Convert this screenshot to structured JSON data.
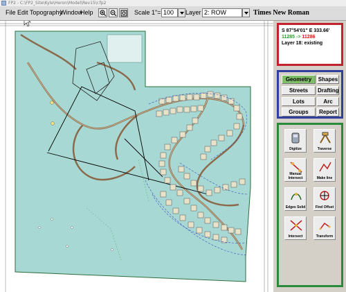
{
  "window": {
    "title": "FP2 - C:\\FP2_Site\\Kyle\\Heron\\Model\\Rev15\\r.fp2"
  },
  "menu": [
    "File",
    "Edit",
    "Topography",
    "Window",
    "Help"
  ],
  "toolbar": {
    "scale_label": "Scale 1\"=",
    "scale_value": "100",
    "layer_label": "Layer",
    "layer_value": "2: ROW",
    "font_name": "Times New Roman"
  },
  "info": {
    "bearing": "S 87°54'01\" E 333.66'",
    "points": "11285 -> 11286",
    "layer": "Layer 18: existing"
  },
  "commands": [
    {
      "label": "Geometry",
      "active": true
    },
    {
      "label": "Shapes",
      "active": false
    },
    {
      "label": "Streets",
      "active": false
    },
    {
      "label": "Drafting",
      "active": false
    },
    {
      "label": "Lots",
      "active": false
    },
    {
      "label": "Arc",
      "active": false
    },
    {
      "label": "Groups",
      "active": false
    },
    {
      "label": "Report",
      "active": false
    }
  ],
  "tools": [
    {
      "label": "Digitize",
      "icon": "digitize-icon"
    },
    {
      "label": "Traverse",
      "icon": "traverse-icon"
    },
    {
      "label": "Manual Intersect",
      "icon": "manual-intersect-icon"
    },
    {
      "label": "Make line",
      "icon": "make-line-icon"
    },
    {
      "label": "Edges Solid",
      "icon": "edges-solid-icon"
    },
    {
      "label": "Find Offset",
      "icon": "find-offset-icon"
    },
    {
      "label": "Intersect",
      "icon": "intersect-icon"
    },
    {
      "label": "Transform",
      "icon": "transform-icon"
    }
  ],
  "colors": {
    "site_fill": "#a8d8d4",
    "road": "#8a6a4a",
    "info_border": "#c0222e",
    "command_border": "#2e3f9e",
    "tool_border": "#2a8a3a",
    "active_button": "#7fbf6a",
    "point_numbers_green": "#2a9d2a",
    "point_numbers_red": "#d62020"
  }
}
